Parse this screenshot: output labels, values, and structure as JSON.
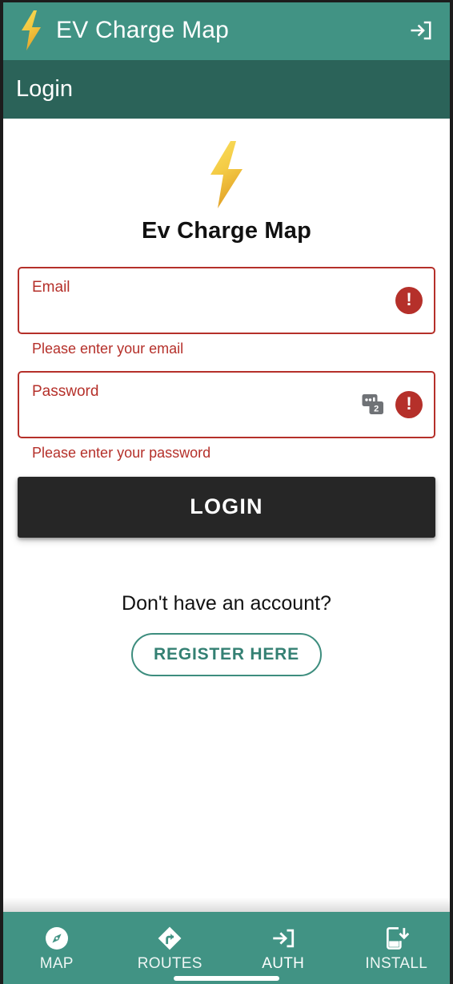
{
  "theme": {
    "appbar_bg": "#419384",
    "subheader_bg": "#2b6359",
    "error_color": "#b5302a",
    "accent_teal": "#348073",
    "login_btn_bg": "#262626",
    "bolt_top": "#f7d84b",
    "bolt_bottom": "#e8a82e"
  },
  "appbar": {
    "title": "EV Charge Map",
    "bolt_icon": "lightning-bolt-icon",
    "action_icon": "login-arrow-icon"
  },
  "subheader": {
    "title": "Login"
  },
  "brand": {
    "bolt_icon": "lightning-bolt-icon",
    "name": "Ev Charge Map"
  },
  "form": {
    "fields": [
      {
        "name": "email",
        "label": "Email",
        "value": "",
        "placeholder": "Email",
        "error": "Please enter your email",
        "has_autofill_icon": false,
        "has_error_icon": true
      },
      {
        "name": "password",
        "label": "Password",
        "value": "",
        "placeholder": "Password",
        "error": "Please enter your password",
        "has_autofill_icon": true,
        "autofill_badge": "2",
        "has_error_icon": true
      }
    ],
    "submit_label": "LOGIN"
  },
  "register": {
    "prompt": "Don't have an account?",
    "button_label": "REGISTER HERE"
  },
  "bottom_nav": {
    "active": "AUTH",
    "items": [
      {
        "label": "MAP",
        "icon": "compass-icon"
      },
      {
        "label": "ROUTES",
        "icon": "route-diamond-icon"
      },
      {
        "label": "AUTH",
        "icon": "login-arrow-icon"
      },
      {
        "label": "INSTALL",
        "icon": "phone-download-icon"
      }
    ]
  }
}
